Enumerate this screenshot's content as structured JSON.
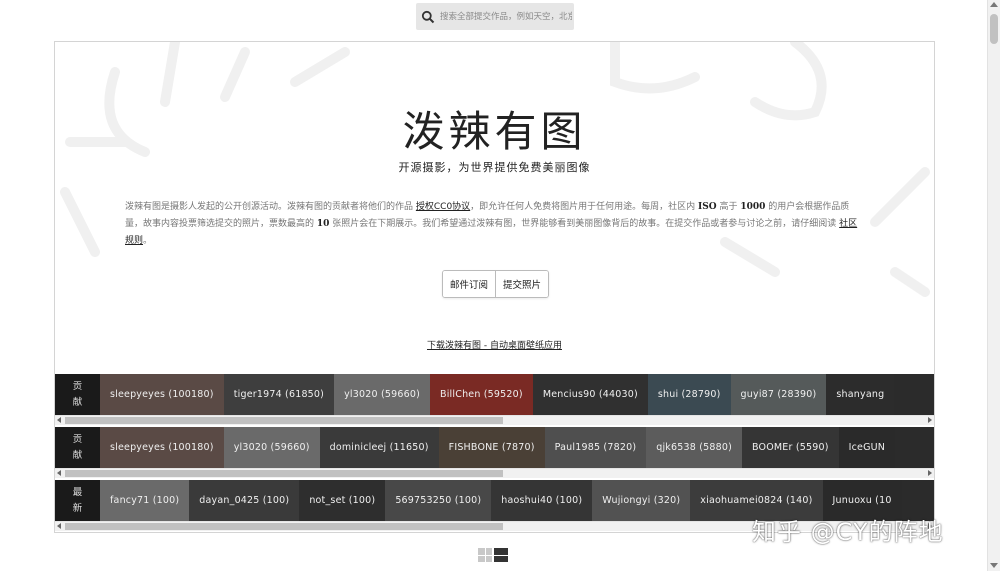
{
  "search": {
    "placeholder": "搜索全部提交作品，例如天空，北京"
  },
  "hero": {
    "title": "泼辣有图",
    "subtitle": "开源摄影，为世界提供免费美丽图像",
    "desc": {
      "p1": "泼辣有图是摄影人发起的公开创源活动。泼辣有图的贡献者将他们的作品 ",
      "license_link": "授权CC0协议",
      "p2": "，即允许任何人免费将图片用于任何用途。每周，社区内 ",
      "iso": "ISO",
      "p3": " 高于 ",
      "threshold": "1000",
      "p4": " 的用户会根据作品质量，故事内容投票筛选提交的照片，票数最高的 ",
      "top_n": "10",
      "p5": " 张照片会在下期展示。我们希望通过泼辣有图，世界能够看到美丽图像背后的故事。在提交作品或者参与讨论之前，请仔细阅读 ",
      "rules_link": "社区规则",
      "p6": "。"
    },
    "buttons": {
      "subscribe": "邮件订阅",
      "submit": "提交照片"
    },
    "download_link": "下载泼辣有图 - 自动桌面壁纸应用"
  },
  "strips": [
    {
      "label": [
        "贡",
        "献"
      ],
      "items": [
        "sleepyeyes (100180)",
        "tiger1974 (61850)",
        "yl3020 (59660)",
        "BillChen (59520)",
        "Mencius90 (44030)",
        "shui (28790)",
        "guyi87 (28390)",
        "shanyang"
      ]
    },
    {
      "label": [
        "贡",
        "献"
      ],
      "items": [
        "sleepyeyes (100180)",
        "yl3020 (59660)",
        "dominicleej (11650)",
        "FISHBONE (7870)",
        "Paul1985 (7820)",
        "qjk6538 (5880)",
        "BOOMEr (5590)",
        "IceGUN"
      ]
    },
    {
      "label": [
        "最",
        "新"
      ],
      "items": [
        "fancy71 (100)",
        "dayan_0425 (100)",
        "not_set (100)",
        "569753250 (100)",
        "haoshui40 (100)",
        "Wujiongyi (320)",
        "xiaohuamei0824 (140)",
        "Junuoxu (10"
      ]
    }
  ],
  "watermark": "知乎 @CY的阵地",
  "colors": {
    "strip_bg": "#2b2b2b",
    "label_bg": "#1a1a1a",
    "border": "#d4d4d4"
  },
  "icons": {
    "search": "search-icon",
    "grid_view": "grid-view-icon",
    "list_view": "list-view-icon"
  }
}
